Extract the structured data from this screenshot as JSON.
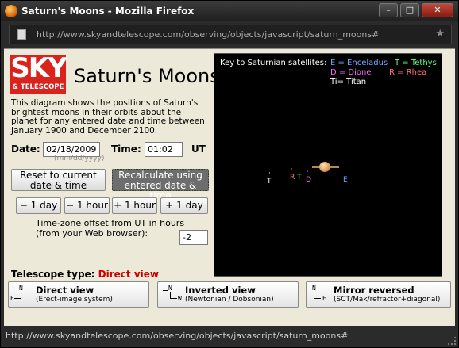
{
  "window": {
    "title": "Saturn's Moons - Mozilla Firefox",
    "url": "http://www.skyandtelescope.com/observing/objects/javascript/saturn_moons#",
    "status_url": "http://www.skyandtelescope.com/observing/objects/javascript/saturn_moons#",
    "controls": [
      "–",
      "□",
      "✕"
    ]
  },
  "logo": {
    "line1": "SKY",
    "line2": "& TELESCOPE"
  },
  "page": {
    "title": "Saturn's Moons",
    "description": "This diagram shows the positions of Saturn's brightest moons in their orbits about the planet for any entered date and time between January 1900 and December 2100."
  },
  "form": {
    "date_label": "Date:",
    "date_value": "02/18/2009",
    "date_hint": "(mm/dd/yyyy)",
    "time_label": "Time:",
    "time_value": "01:02",
    "time_unit": "UT",
    "reset_button": "Reset to current date & time",
    "recalc_button": "Recalculate using entered date & time",
    "step_buttons": [
      "− 1 day",
      "− 1 hour",
      "+ 1 hour",
      "+ 1 day"
    ],
    "tz_label": "Time-zone offset from UT in hours (from your Web browser):",
    "tz_value": "-2"
  },
  "telescope": {
    "label": "Telescope type:",
    "selected": "Direct view",
    "views": [
      {
        "icon_top": "N",
        "icon_bottom": "E",
        "title": "Direct view",
        "subtitle": "(Erect-image system)"
      },
      {
        "icon_top": "N",
        "icon_bottom": "W",
        "title": "Inverted view",
        "subtitle": "(Newtonian / Dobsonian)"
      },
      {
        "icon_top": "N",
        "icon_bottom": "E",
        "title": "Mirror reversed",
        "subtitle": "(SCT/Mak/refractor+diagonal)"
      }
    ]
  },
  "sky": {
    "key_title": "Key to Saturnian satellites:",
    "key": [
      {
        "text": "E = Enceladus",
        "color": "#6fa8ff"
      },
      {
        "text": "T = Tethys",
        "color": "#66ff88"
      },
      {
        "text": "D = Dione",
        "color": "#ff66ff"
      },
      {
        "text": "R = Rhea",
        "color": "#ff7777"
      },
      {
        "text": "Ti= Titan",
        "color": "#ffffff"
      }
    ],
    "moons": [
      {
        "label": "Ti",
        "color": "#ffffff"
      },
      {
        "label": "R",
        "color": "#ff7777"
      },
      {
        "label": "T",
        "color": "#66ff88"
      },
      {
        "label": "D",
        "color": "#ff66ff"
      },
      {
        "label": "E",
        "color": "#6fa8ff"
      }
    ]
  }
}
